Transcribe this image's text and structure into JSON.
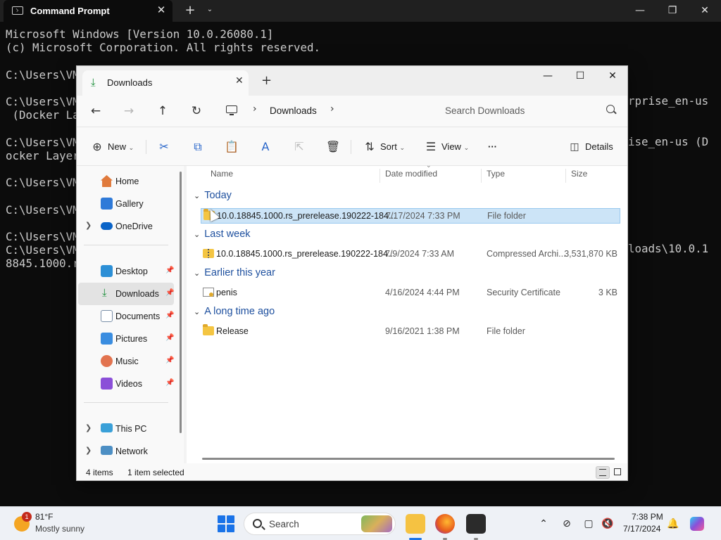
{
  "cmd": {
    "tab_title": "Command Prompt",
    "lines": [
      "Microsoft Windows [Version 10.0.26080.1]",
      "(c) Microsoft Corporation. All rights reserved.",
      "",
      "C:\\Users\\VM",
      "",
      "C:\\Users\\VM",
      " (Docker La",
      "",
      "C:\\Users\\VM",
      "ocker Layer",
      "",
      "C:\\Users\\VM",
      "",
      "C:\\Users\\VM",
      "",
      "C:\\Users\\VM",
      "C:\\Users\\VM",
      "8845.1000.r"
    ],
    "right_fragments": [
      "rprise_en-us",
      "ise_en-us (D",
      "loads\\10.0.1"
    ]
  },
  "explorer": {
    "tab_title": "Downloads",
    "address": {
      "location": "Downloads"
    },
    "search": {
      "placeholder": "Search Downloads"
    },
    "toolbar": {
      "new_label": "New",
      "sort_label": "Sort",
      "view_label": "View",
      "details_label": "Details",
      "more_label": "···"
    },
    "sidebar": {
      "top": [
        {
          "label": "Home",
          "icon": "home-icon"
        },
        {
          "label": "Gallery",
          "icon": "gallery-icon"
        },
        {
          "label": "OneDrive",
          "icon": "cloud-icon"
        }
      ],
      "pinned": [
        {
          "label": "Desktop",
          "icon": "desktop-icon"
        },
        {
          "label": "Downloads",
          "icon": "download-icon"
        },
        {
          "label": "Documents",
          "icon": "documents-icon"
        },
        {
          "label": "Pictures",
          "icon": "pictures-icon"
        },
        {
          "label": "Music",
          "icon": "music-icon"
        },
        {
          "label": "Videos",
          "icon": "videos-icon"
        }
      ],
      "bottom": [
        {
          "label": "This PC",
          "icon": "computer-icon"
        },
        {
          "label": "Network",
          "icon": "network-icon"
        }
      ]
    },
    "columns": [
      "Name",
      "Date modified",
      "Type",
      "Size"
    ],
    "groups": [
      {
        "title": "Today",
        "files": [
          {
            "name": "10.0.18845.1000.rs_prerelease.190222-184...",
            "date": "7/17/2024 7:33 PM",
            "type": "File folder",
            "size": "",
            "icon": "folder-icon",
            "selected": true
          }
        ]
      },
      {
        "title": "Last week",
        "files": [
          {
            "name": "10.0.18845.1000.rs_prerelease.190222-184...",
            "date": "7/9/2024 7:33 AM",
            "type": "Compressed Archi...",
            "size": "3,531,870 KB",
            "icon": "zip-icon",
            "selected": false
          }
        ]
      },
      {
        "title": "Earlier this year",
        "files": [
          {
            "name": "penis",
            "date": "4/16/2024 4:44 PM",
            "type": "Security Certificate",
            "size": "3 KB",
            "icon": "certificate-icon",
            "selected": false
          }
        ]
      },
      {
        "title": "A long time ago",
        "files": [
          {
            "name": "Release",
            "date": "9/16/2021 1:38 PM",
            "type": "File folder",
            "size": "",
            "icon": "folder-icon",
            "selected": false
          }
        ]
      }
    ],
    "status": {
      "count": "4 items",
      "selection": "1 item selected"
    }
  },
  "taskbar": {
    "weather": {
      "temp": "81°F",
      "desc": "Mostly sunny",
      "badge": "1"
    },
    "search_label": "Search",
    "clock": {
      "time": "7:38 PM",
      "date": "7/17/2024"
    }
  }
}
